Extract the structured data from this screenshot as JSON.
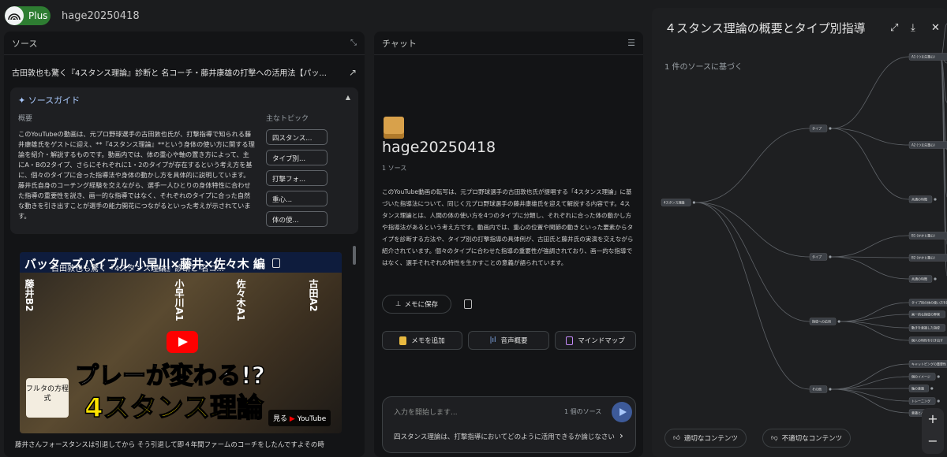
{
  "app": {
    "plan_badge": "Plus",
    "notebook_title": "hage20250418"
  },
  "source_panel": {
    "header": "ソース",
    "source_title": "古田敦也も驚く『4スタンス理論』診断と 名コーチ・藤井康雄の打撃への活用法【パッ...",
    "guide": {
      "title": "ソースガイド",
      "summary_label": "概要",
      "summary": "このYouTubeの動画は、元プロ野球選手の古田敦也氏が、打撃指導で知られる藤井康雄氏をゲストに迎え、**『4スタンス理論』**という身体の使い方に関する理論を紹介・解説するものです。動画内では、体の重心や軸の置き方によって、主にA・Bの2タイプ、さらにそれぞれに1・2のタイプが存在するという考え方を基に、個々のタイプに合った指導法や身体の動かし方を具体的に説明しています。藤井氏自身のコーチング経験を交えながら、選手一人ひとりの身体特性に合わせた指導の重要性を説き、画一的な指導ではなく、それぞれのタイプに合った自然な動きを引き出すことが選手の能力開花につながるといった考えが示されています。",
      "topics_label": "主なトピック",
      "topics": [
        "四スタンス...",
        "タイプ別...",
        "打撃フォ...",
        "重心...",
        "体の使..."
      ]
    },
    "video": {
      "banner": "バッターズバイブル 小早川×藤井×佐々木 編",
      "overlay_title": "古田敦也も驚く『4スタンス理論』診断と 名コ...",
      "names": [
        "藤井B2",
        "小早川A1",
        "佐々木A1",
        "古田A2"
      ],
      "headline": "プレーが変わる!?",
      "big_text": "4スタンス理論",
      "channel_badge": "フルタの方程式",
      "watch_label": "見る",
      "youtube_label": "YouTube"
    },
    "transcript_line": "藤井さんフォースタンスは引退してから そう引退して即４年間ファームのコーチをしたんですよその時"
  },
  "chat_panel": {
    "header": "チャット",
    "notebook_name": "hage20250418",
    "source_count": "1 ソース",
    "summary": "このYouTube動画の転写は、元プロ野球選手の古田敦也氏が提唱する「4スタンス理論」に基づいた指導法について、同じく元プロ野球選手の藤井康雄氏を迎えて解説する内容です。4スタンス理論とは、人間の体の使い方を4つのタイプに分類し、それぞれに合った体の動かし方や指導法があるという考え方です。動画内では、重心の位置や関節の動きといった要素からタイプを診断する方法や、タイプ別の打撃指導の具体例が、古田氏と藤井氏の実演を交えながら紹介されています。個々のタイプに合わせた指導の重要性が強調されており、画一的な指導ではなく、選手それぞれの特性を生かすことの意義が語られています。",
    "save_memo": "メモに保存",
    "chips": [
      "メモを追加",
      "音声概要",
      "マインドマップ"
    ],
    "input_placeholder": "入力を開始します...",
    "input_source_count": "1 個のソース",
    "suggestion": "四スタンス理論は、打撃指導においてどのように活用できるか論じなさい"
  },
  "mindmap_panel": {
    "title": "４スタンス理論の概要とタイプ別指導",
    "subtitle": "1 件のソースに基づく",
    "root": "4スタンス理論",
    "branches": [
      {
        "label": "タイプ",
        "children": [
          "A1 (つま先重心)",
          "A2 (つま先重心)",
          "共通の特徴"
        ]
      },
      {
        "label": "タイプ",
        "children": [
          "B1 (かかと重心)",
          "B2 (かかと重心)",
          "共通の特徴"
        ]
      },
      {
        "label": "指導への応用",
        "children": [
          "タイプ別の体の使い方を指導",
          "画一的な指導の弊害",
          "動きを意識した指導",
          "個人の特性を引き出す"
        ]
      },
      {
        "label": "その他",
        "children": [
          "キャットピングの重要性",
          "個のイメージ",
          "軸の意識",
          "トレーニング",
          "意識とバランス"
        ]
      }
    ],
    "feedback_good": "適切なコンテンツ",
    "feedback_bad": "不適切なコンテンツ",
    "zoom_in": "+",
    "zoom_out": "−"
  }
}
